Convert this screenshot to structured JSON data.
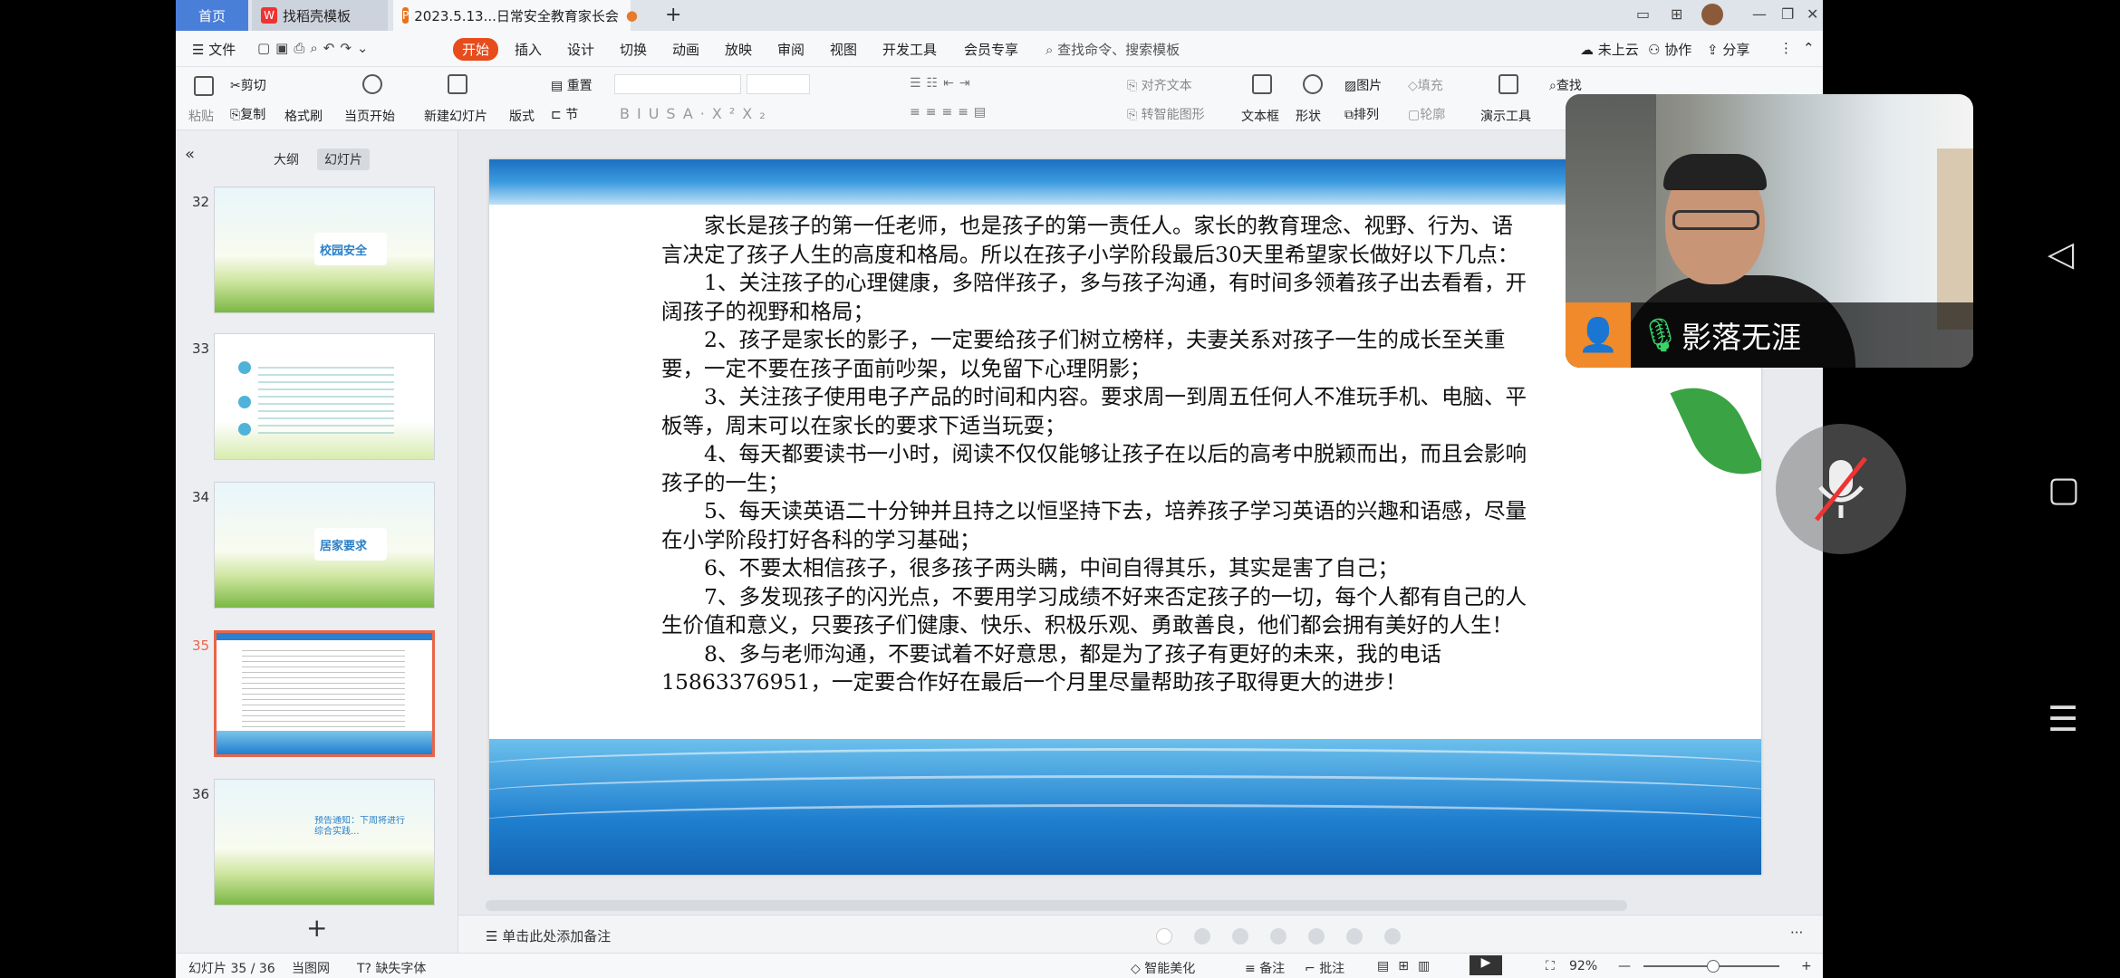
{
  "tabs": [
    {
      "label": "首页"
    },
    {
      "label": "找稻壳模板"
    },
    {
      "label": "2023.5.13...日常安全教育家长会"
    }
  ],
  "menu": [
    "文件",
    "开始",
    "插入",
    "设计",
    "切换",
    "动画",
    "放映",
    "审阅",
    "视图",
    "开发工具",
    "会员专享"
  ],
  "search_placeholder": "查找命令、搜索模板",
  "menu_right": [
    "未上云",
    "协作",
    "分享"
  ],
  "ribbon": {
    "paste": "粘贴",
    "cut": "剪切",
    "copy": "复制",
    "format": "格式刷",
    "from_current": "当页开始",
    "new_slide": "新建幻灯片",
    "layout": "版式",
    "section": "节",
    "reset": "重置",
    "align_text": "对齐文本",
    "smart": "转智能图形",
    "textbox": "文本框",
    "shape": "形状",
    "picture": "图片",
    "fill": "填充",
    "arrange": "排列",
    "outline": "轮廓",
    "present": "演示工具",
    "find": "查找"
  },
  "panel_tabs": [
    "大纲",
    "幻灯片"
  ],
  "thumbs": [
    {
      "num": "32",
      "label": "校园安全"
    },
    {
      "num": "33",
      "label": ""
    },
    {
      "num": "34",
      "label": "居家要求"
    },
    {
      "num": "35",
      "label": ""
    },
    {
      "num": "36",
      "label": "预告通知：下周将进行综合实践..."
    }
  ],
  "slide": {
    "paragraphs": [
      "家长是孩子的第一任老师，也是孩子的第一责任人。家长的教育理念、视野、行为、语言决定了孩子人生的高度和格局。所以在孩子小学阶段最后30天里希望家长做好以下几点：",
      "1、关注孩子的心理健康，多陪伴孩子，多与孩子沟通，有时间多领着孩子出去看看，开阔孩子的视野和格局；",
      "2、孩子是家长的影子，一定要给孩子们树立榜样，夫妻关系对孩子一生的成长至关重要，一定不要在孩子面前吵架，以免留下心理阴影；",
      "3、关注孩子使用电子产品的时间和内容。要求周一到周五任何人不准玩手机、电脑、平板等，周末可以在家长的要求下适当玩耍；",
      "4、每天都要读书一小时，阅读不仅仅能够让孩子在以后的高考中脱颖而出，而且会影响孩子的一生；",
      " 5、每天读英语二十分钟并且持之以恒坚持下去，培养孩子学习英语的兴趣和语感，尽量在小学阶段打好各科的学习基础；",
      "6、不要太相信孩子，很多孩子两头瞒，中间自得其乐，其实是害了自己；",
      "7、多发现孩子的闪光点，不要用学习成绩不好来否定孩子的一切，每个人都有自己的人生价值和意义，只要孩子们健康、快乐、积极乐观、勇敢善良，他们都会拥有美好的人生！",
      "8、多与老师沟通，不要试着不好意思，都是为了孩子有更好的未来，我的电话15863376951，一定要合作好在最后一个月里尽量帮助孩子取得更大的进步！"
    ]
  },
  "notes_placeholder": "单击此处添加备注",
  "status": {
    "slide": "幻灯片 35 / 36",
    "theme": "当图网",
    "missing_font": "缺失字体",
    "beautify": "智能美化",
    "notes": "备注",
    "comments": "批注",
    "zoom": "92%"
  },
  "video": {
    "name": "影落无涯"
  }
}
